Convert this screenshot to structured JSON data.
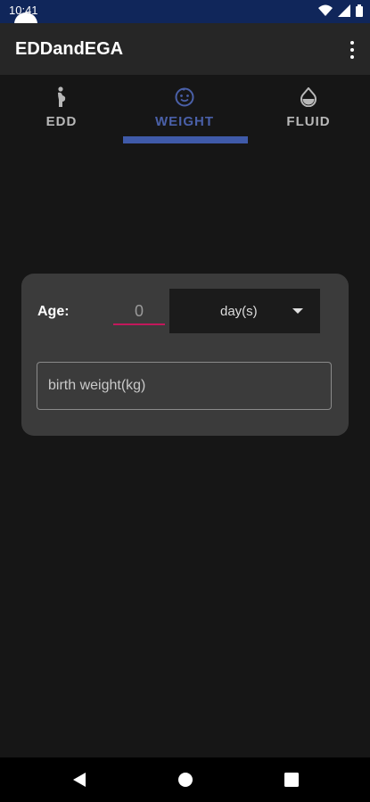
{
  "status_bar": {
    "time": "10:41",
    "icons": [
      "wifi-icon",
      "signal-icon",
      "battery-icon"
    ]
  },
  "app_bar": {
    "title": "EDDandEGA",
    "menu_icon": "more-vert-icon"
  },
  "tabs": [
    {
      "label": "EDD",
      "icon": "pregnant-woman-icon",
      "active": false
    },
    {
      "label": "WEIGHT",
      "icon": "baby-face-icon",
      "active": true
    },
    {
      "label": "FLUID",
      "icon": "drop-icon",
      "active": false
    }
  ],
  "form": {
    "age_label": "Age:",
    "age_value": "0",
    "unit_selected": "day(s)",
    "birth_weight_placeholder": "birth weight(kg)"
  },
  "nav_bar": {
    "buttons": [
      "back-icon",
      "home-icon",
      "recents-icon"
    ]
  },
  "colors": {
    "accent": "#3f5aa9",
    "input_underline": "#c2185b",
    "status_bar": "#10265a",
    "app_bar": "#262626",
    "background": "#161616",
    "card": "#3b3b3b"
  }
}
